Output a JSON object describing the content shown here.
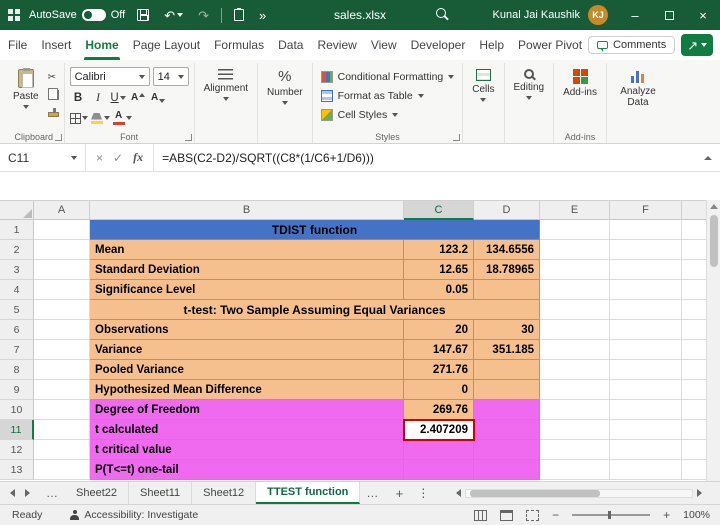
{
  "titlebar": {
    "autosave_label": "AutoSave",
    "autosave_state": "Off",
    "filename": "sales.xlsx",
    "user_name": "Kunal Jai Kaushik",
    "user_initials": "KJ"
  },
  "menu": {
    "items": [
      "File",
      "Insert",
      "Home",
      "Page Layout",
      "Formulas",
      "Data",
      "Review",
      "View",
      "Developer",
      "Help",
      "Power Pivot"
    ],
    "active": "Home",
    "comments_label": "Comments"
  },
  "ribbon": {
    "paste_label": "Paste",
    "font_name": "Calibri",
    "font_size": "14",
    "alignment_label": "Alignment",
    "number_label": "Number",
    "styles_buttons": [
      "Conditional Formatting",
      "Format as Table",
      "Cell Styles"
    ],
    "cells_label": "Cells",
    "editing_label": "Editing",
    "addins_label": "Add-ins",
    "analyze_label": "Analyze Data",
    "group_labels": {
      "clipboard": "Clipboard",
      "font": "Font",
      "styles": "Styles",
      "addins": "Add-ins"
    }
  },
  "formula_bar": {
    "name_box": "C11",
    "formula": "=ABS(C2-D2)/SQRT((C8*(1/C6+1/D6)))"
  },
  "grid": {
    "col_headers": [
      "A",
      "B",
      "C",
      "D",
      "E",
      "F"
    ],
    "active_cell": "C11",
    "rows": [
      {
        "num": "1",
        "b": "TDIST function",
        "c": "",
        "d": ""
      },
      {
        "num": "2",
        "b": "Mean",
        "c": "123.2",
        "d": "134.6556"
      },
      {
        "num": "3",
        "b": "Standard Deviation",
        "c": "12.65",
        "d": "18.78965"
      },
      {
        "num": "4",
        "b": "Significance Level",
        "c": "0.05",
        "d": ""
      },
      {
        "num": "5",
        "b": "t-test: Two Sample Assuming Equal Variances",
        "c": "",
        "d": ""
      },
      {
        "num": "6",
        "b": "Observations",
        "c": "20",
        "d": "30"
      },
      {
        "num": "7",
        "b": "Variance",
        "c": "147.67",
        "d": "351.185"
      },
      {
        "num": "8",
        "b": "Pooled Variance",
        "c": "271.76",
        "d": ""
      },
      {
        "num": "9",
        "b": "Hypothesized Mean Difference",
        "c": "0",
        "d": ""
      },
      {
        "num": "10",
        "b": "Degree of Freedom",
        "c": "269.76",
        "d": ""
      },
      {
        "num": "11",
        "b": "t calculated",
        "c": "2.407209",
        "d": ""
      },
      {
        "num": "12",
        "b": "t critical value",
        "c": "",
        "d": ""
      },
      {
        "num": "13",
        "b": "P(T<=t) one-tail",
        "c": "",
        "d": ""
      }
    ]
  },
  "sheet_tabs": {
    "tabs": [
      "Sheet22",
      "Sheet11",
      "Sheet12",
      "TTEST function"
    ],
    "active": "TTEST function"
  },
  "status_bar": {
    "mode": "Ready",
    "accessibility": "Accessibility: Investigate",
    "zoom": "100%"
  },
  "icons": {
    "undo": "↶",
    "redo": "↷",
    "more_commands": "»",
    "scissors": "✂",
    "share_arrow": "↗",
    "bold": "B",
    "italic": "I",
    "underline": "U",
    "font_a": "A",
    "percent": "%",
    "fx": "fx",
    "cancel": "×",
    "check": "✓",
    "minimize": "–",
    "close": "×",
    "plus": "+",
    "ellipsis": "…",
    "more_dots": "⋮",
    "zoom_out": "−",
    "zoom_in": "+"
  },
  "colors": {
    "titlebar_green": "#185C37",
    "accent_green": "#107C41",
    "header_blue": "#4472C4",
    "table_orange": "#F5C08E",
    "table_pink": "#EF6AEF",
    "highlight_red": "#D40000",
    "avatar_orange": "#C88A28"
  }
}
